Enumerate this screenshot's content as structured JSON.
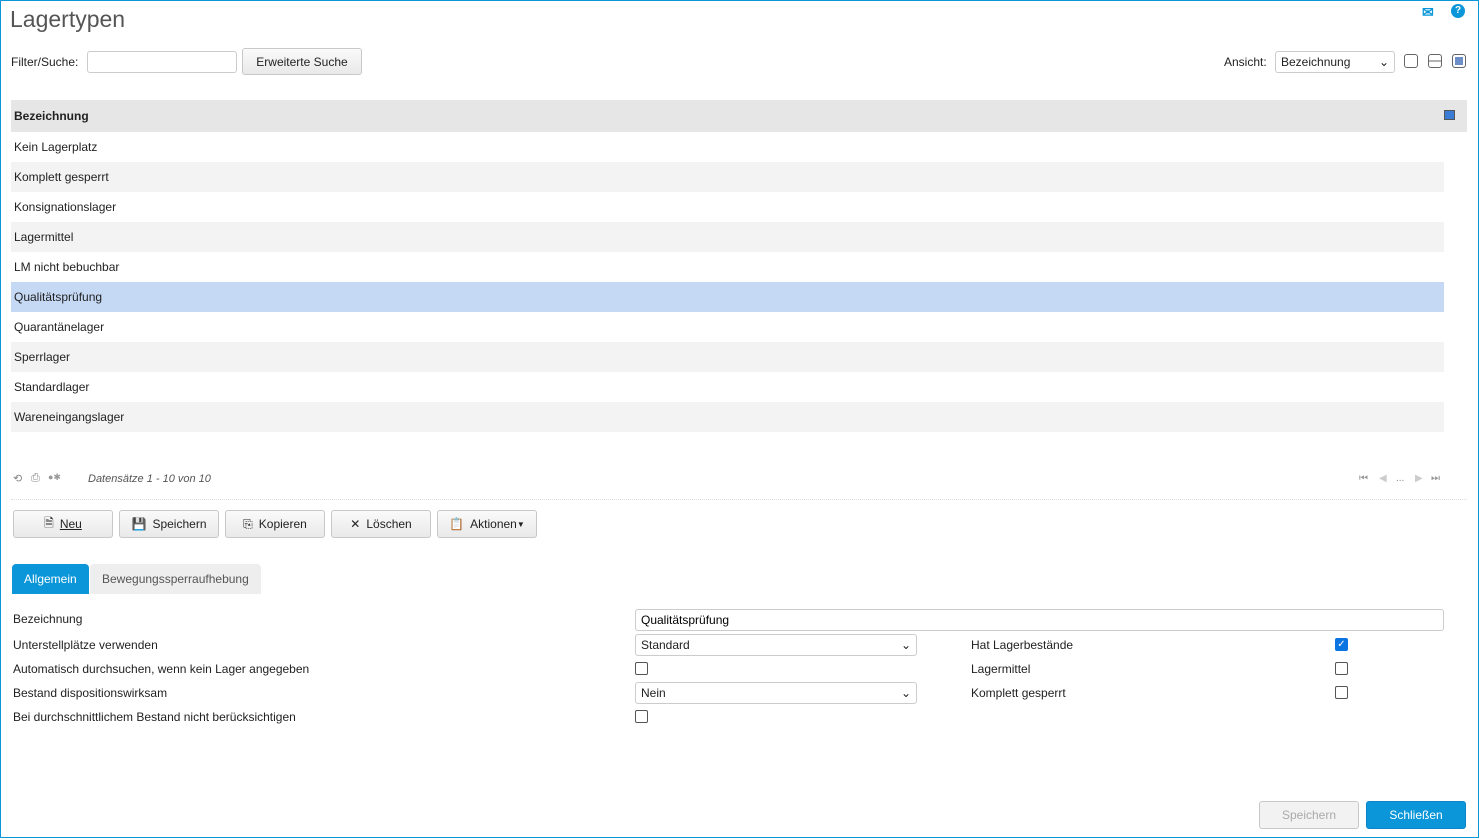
{
  "title": "Lagertypen",
  "filter": {
    "label": "Filter/Suche:",
    "value": "",
    "advanced": "Erweiterte Suche"
  },
  "view": {
    "label": "Ansicht:",
    "selected": "Bezeichnung"
  },
  "grid": {
    "header": "Bezeichnung",
    "rows": [
      "Kein Lagerplatz",
      "Komplett gesperrt",
      "Konsignationslager",
      "Lagermittel",
      "LM nicht bebuchbar",
      "Qualitätsprüfung",
      "Quarantänelager",
      "Sperrlager",
      "Standardlager",
      "Wareneingangslager"
    ],
    "selected_index": 5,
    "records": "Datensätze 1 - 10 von 10",
    "pager_ellipsis": "..."
  },
  "toolbar": {
    "new": "Neu",
    "save": "Speichern",
    "copy": "Kopieren",
    "delete": "Löschen",
    "actions": "Aktionen"
  },
  "tabs": [
    "Allgemein",
    "Bewegungssperraufhebung"
  ],
  "form": {
    "bezeichnung_label": "Bezeichnung",
    "bezeichnung_value": "Qualitätsprüfung",
    "unterstell_label": "Unterstellplätze verwenden",
    "unterstell_value": "Standard",
    "auto_label": "Automatisch durchsuchen, wenn kein Lager angegeben",
    "auto_checked": false,
    "dispo_label": "Bestand dispositionswirksam",
    "dispo_value": "Nein",
    "avg_label": "Bei durchschnittlichem Bestand nicht berücksichtigen",
    "avg_checked": false,
    "hat_label": "Hat Lagerbestände",
    "hat_checked": true,
    "lm_label": "Lagermittel",
    "lm_checked": false,
    "gesperrt_label": "Komplett gesperrt",
    "gesperrt_checked": false
  },
  "footer": {
    "save": "Speichern",
    "close": "Schließen"
  },
  "colors": {
    "accent": "#0a96d8",
    "selected_row": "#c5d9f5"
  }
}
